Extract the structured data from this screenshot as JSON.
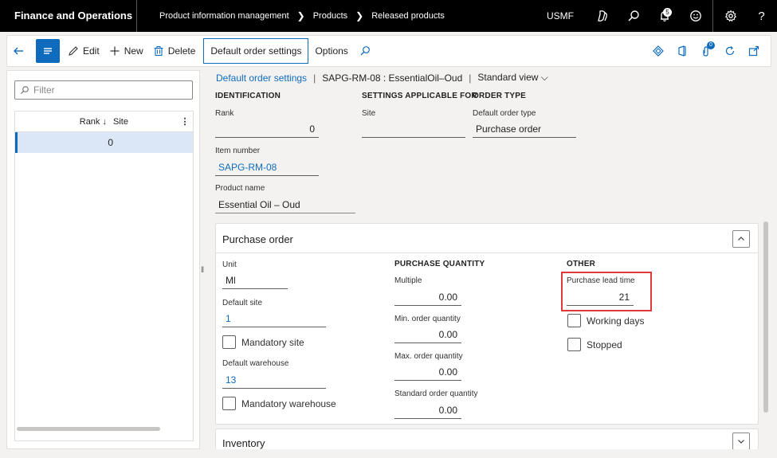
{
  "topbar": {
    "app_title": "Finance and Operations",
    "breadcrumbs": [
      "Product information management",
      "Products",
      "Released products"
    ],
    "company": "USMF",
    "notification_count": "5",
    "icons": [
      "copilot-icon",
      "search-icon",
      "bell-icon",
      "smiley-icon",
      "gear-icon",
      "help-icon"
    ]
  },
  "actionbar": {
    "edit_label": "Edit",
    "new_label": "New",
    "delete_label": "Delete",
    "active_tab_label": "Default order settings",
    "options_label": "Options",
    "attachments_count": "0"
  },
  "list": {
    "filter_placeholder": "Filter",
    "columns": [
      "Rank",
      "Site"
    ],
    "rows": [
      {
        "rank": "0",
        "site": ""
      }
    ]
  },
  "details": {
    "breadcrumb_link": "Default order settings",
    "breadcrumb_item": "SAPG-RM-08 : EssentialOil–Oud",
    "view_label": "Standard view",
    "identification": {
      "heading": "IDENTIFICATION",
      "rank_label": "Rank",
      "rank_value": "0",
      "item_number_label": "Item number",
      "item_number_value": "SAPG-RM-08",
      "product_name_label": "Product name",
      "product_name_value": "Essential Oil – Oud"
    },
    "settings_applicable": {
      "heading": "SETTINGS APPLICABLE FOR",
      "site_label": "Site",
      "site_value": ""
    },
    "order_type": {
      "heading": "ORDER TYPE",
      "default_order_type_label": "Default order type",
      "default_order_type_value": "Purchase order"
    }
  },
  "purchase_order": {
    "title": "Purchase order",
    "unit_label": "Unit",
    "unit_value": "Ml",
    "default_site_label": "Default site",
    "default_site_value": "1",
    "mandatory_site_label": "Mandatory site",
    "default_warehouse_label": "Default warehouse",
    "default_warehouse_value": "13",
    "mandatory_warehouse_label": "Mandatory warehouse",
    "purchase_quantity_heading": "PURCHASE QUANTITY",
    "multiple_label": "Multiple",
    "multiple_value": "0.00",
    "min_qty_label": "Min. order quantity",
    "min_qty_value": "0.00",
    "max_qty_label": "Max. order quantity",
    "max_qty_value": "0.00",
    "std_qty_label": "Standard order quantity",
    "std_qty_value": "0.00",
    "other_heading": "OTHER",
    "lead_time_label": "Purchase lead time",
    "lead_time_value": "21",
    "working_days_label": "Working days",
    "stopped_label": "Stopped"
  },
  "inventory": {
    "title": "Inventory"
  },
  "colors": {
    "accent": "#0f6cbd",
    "highlight": "#e03a3a",
    "topbar": "#000000"
  }
}
